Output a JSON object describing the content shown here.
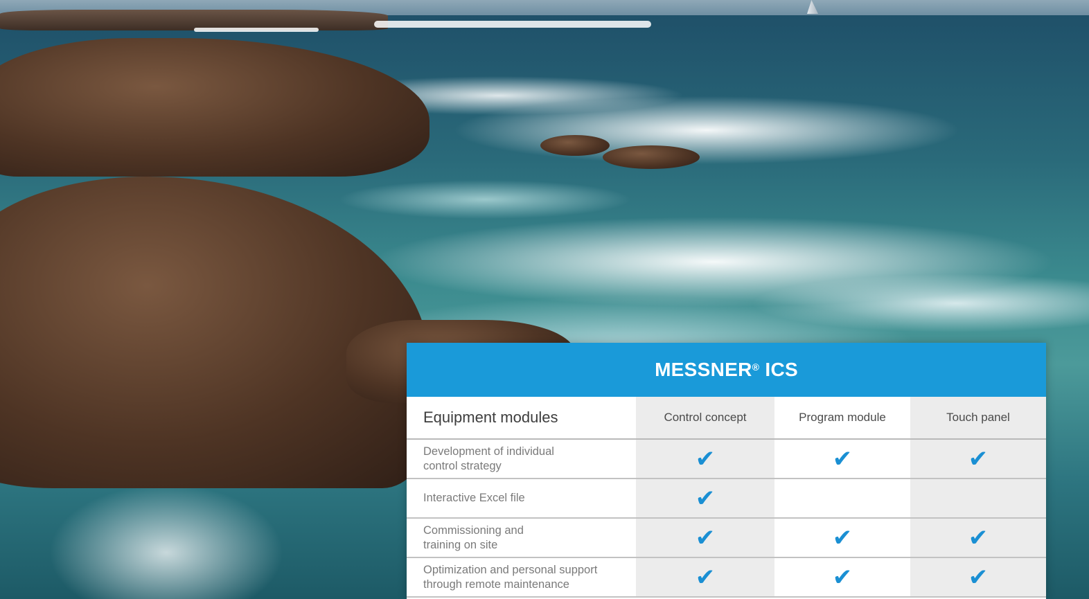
{
  "table": {
    "title": "MESSNER",
    "title_reg": "®",
    "title_suffix": "ICS",
    "first_header": "Equipment modules",
    "columns": [
      "Control concept",
      "Program module",
      "Touch panel"
    ],
    "check_symbol": "✔",
    "rows": [
      {
        "label_lines": [
          "Development of individual",
          "control strategy"
        ],
        "checks": [
          true,
          true,
          true
        ]
      },
      {
        "label_lines": [
          "Interactive Excel file"
        ],
        "checks": [
          true,
          false,
          false
        ]
      },
      {
        "label_lines": [
          "Commissioning and",
          "training on site"
        ],
        "checks": [
          true,
          true,
          true
        ]
      },
      {
        "label_lines": [
          "Optimization and personal support",
          "through remote maintenance"
        ],
        "checks": [
          true,
          true,
          true
        ]
      }
    ]
  },
  "colors": {
    "header_blue": "#1a9ad9",
    "check_blue": "#1a8fd3",
    "column_shade": "#ececec"
  },
  "icons": {
    "check": "check-icon"
  }
}
